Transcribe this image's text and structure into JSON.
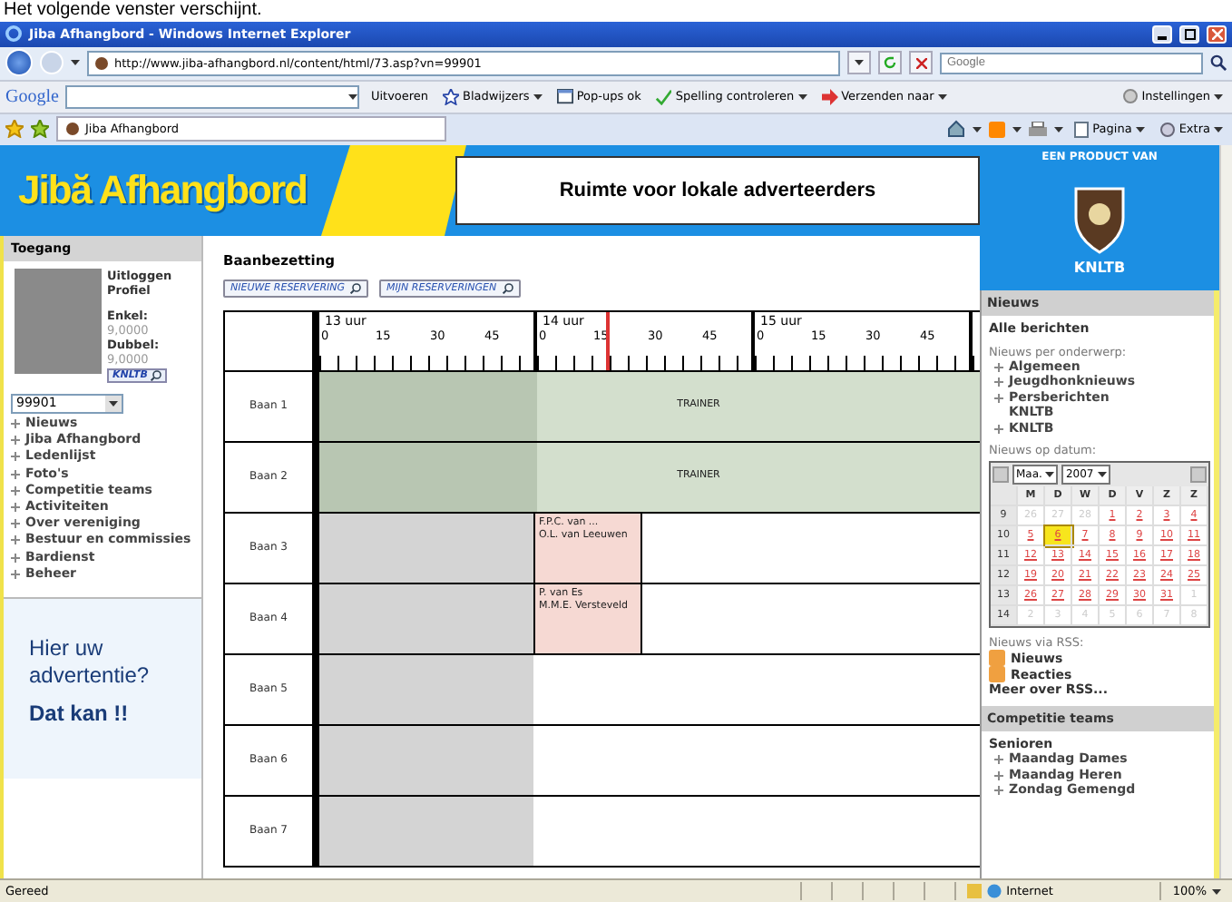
{
  "caption": "Het volgende venster verschijnt.",
  "window": {
    "title": "Jiba Afhangbord - Windows Internet Explorer"
  },
  "address_bar": {
    "url": "http://www.jiba-afhangbord.nl/content/html/73.asp?vn=99901",
    "search_placeholder": "Google"
  },
  "google_toolbar": {
    "logo": "Google",
    "search_button": "Uitvoeren",
    "items": [
      {
        "label": "Bladwijzers",
        "kind": "star",
        "dropdown": true
      },
      {
        "label": "Pop-ups ok",
        "kind": "popup",
        "dropdown": false
      },
      {
        "label": "Spelling controleren",
        "kind": "spell",
        "dropdown": true
      },
      {
        "label": "Verzenden naar",
        "kind": "send",
        "dropdown": true
      }
    ],
    "settings": "Instellingen"
  },
  "tab": {
    "title": "Jiba Afhangbord"
  },
  "command_bar": [
    {
      "label": "Pagina",
      "kind": "page"
    },
    {
      "label": "Extra",
      "kind": "tools"
    }
  ],
  "site_header": {
    "logo": "Jibă Afhangbord",
    "ad": "Ruimte voor lokale adverteerders",
    "product_of": "EEN PRODUCT VAN",
    "brand": "KNLTB"
  },
  "login": {
    "heading": "Toegang",
    "links": [
      "Uitloggen",
      "Profiel"
    ],
    "ratings": [
      {
        "label": "Enkel:",
        "value": "9,0000"
      },
      {
        "label": "Dubbel:",
        "value": "9,0000"
      }
    ],
    "badge": "KNLTB",
    "member_select": "99901"
  },
  "menu": [
    "Nieuws",
    "Jiba Afhangbord",
    "Ledenlijst",
    "Foto's",
    "Competitie teams",
    "Activiteiten",
    "Over vereniging",
    "Bestuur en commissies",
    "Bardienst",
    "Beheer"
  ],
  "advert": {
    "title": "Hier uw advertentie?",
    "subtitle": "Dat kan !!"
  },
  "schedule": {
    "title": "Baanbezetting",
    "buttons": [
      "NIEUWE RESERVERING",
      "MIJN RESERVERINGEN"
    ],
    "hours": [
      {
        "label": "13 uur",
        "minutes": [
          "0",
          "15",
          "30",
          "45"
        ]
      },
      {
        "label": "14 uur",
        "minutes": [
          "0",
          "15",
          "30",
          "45"
        ]
      },
      {
        "label": "15 uur",
        "minutes": [
          "0",
          "15",
          "30",
          "45"
        ]
      }
    ],
    "courts": [
      {
        "name": "Baan 1",
        "booking": {
          "kind": "trainer",
          "lines": [
            "TRAINER"
          ]
        }
      },
      {
        "name": "Baan 2",
        "booking": {
          "kind": "trainer",
          "lines": [
            "TRAINER"
          ]
        }
      },
      {
        "name": "Baan 3",
        "booking": {
          "kind": "reservation",
          "lines": [
            "F.P.C. van ...",
            "O.L. van Leeuwen"
          ]
        }
      },
      {
        "name": "Baan 4",
        "booking": {
          "kind": "reservation",
          "lines": [
            "P. van Es",
            "M.M.E. Versteveld"
          ]
        }
      },
      {
        "name": "Baan 5"
      },
      {
        "name": "Baan 6"
      },
      {
        "name": "Baan 7"
      }
    ]
  },
  "news": {
    "heading": "Nieuws",
    "all": "Alle berichten",
    "by_topic": "Nieuws per onderwerp:",
    "topics": [
      "Algemeen",
      "Jeugdhonknieuws",
      "Persberichten KNLTB",
      "KNLTB"
    ],
    "by_date": "Nieuws op datum:"
  },
  "calendar": {
    "month": "Maa.",
    "year": "2007",
    "weekdays": [
      "M",
      "D",
      "W",
      "D",
      "V",
      "Z",
      "Z"
    ],
    "weeks": [
      {
        "number": "9",
        "days": [
          {
            "day": "26",
            "muted": true,
            "selected": false
          },
          {
            "day": "27",
            "muted": true,
            "selected": false
          },
          {
            "day": "28",
            "muted": true,
            "selected": false
          },
          {
            "day": "1",
            "muted": false,
            "selected": false
          },
          {
            "day": "2",
            "muted": false,
            "selected": false
          },
          {
            "day": "3",
            "muted": false,
            "selected": false
          },
          {
            "day": "4",
            "muted": false,
            "selected": false
          }
        ]
      },
      {
        "number": "10",
        "days": [
          {
            "day": "5",
            "muted": false,
            "selected": false
          },
          {
            "day": "6",
            "muted": false,
            "selected": true
          },
          {
            "day": "7",
            "muted": false,
            "selected": false
          },
          {
            "day": "8",
            "muted": false,
            "selected": false
          },
          {
            "day": "9",
            "muted": false,
            "selected": false
          },
          {
            "day": "10",
            "muted": false,
            "selected": false
          },
          {
            "day": "11",
            "muted": false,
            "selected": false
          }
        ]
      },
      {
        "number": "11",
        "days": [
          {
            "day": "12",
            "muted": false,
            "selected": false
          },
          {
            "day": "13",
            "muted": false,
            "selected": false
          },
          {
            "day": "14",
            "muted": false,
            "selected": false
          },
          {
            "day": "15",
            "muted": false,
            "selected": false
          },
          {
            "day": "16",
            "muted": false,
            "selected": false
          },
          {
            "day": "17",
            "muted": false,
            "selected": false
          },
          {
            "day": "18",
            "muted": false,
            "selected": false
          }
        ]
      },
      {
        "number": "12",
        "days": [
          {
            "day": "19",
            "muted": false,
            "selected": false
          },
          {
            "day": "20",
            "muted": false,
            "selected": false
          },
          {
            "day": "21",
            "muted": false,
            "selected": false
          },
          {
            "day": "22",
            "muted": false,
            "selected": false
          },
          {
            "day": "23",
            "muted": false,
            "selected": false
          },
          {
            "day": "24",
            "muted": false,
            "selected": false
          },
          {
            "day": "25",
            "muted": false,
            "selected": false
          }
        ]
      },
      {
        "number": "13",
        "days": [
          {
            "day": "26",
            "muted": false,
            "selected": false
          },
          {
            "day": "27",
            "muted": false,
            "selected": false
          },
          {
            "day": "28",
            "muted": false,
            "selected": false
          },
          {
            "day": "29",
            "muted": false,
            "selected": false
          },
          {
            "day": "30",
            "muted": false,
            "selected": false
          },
          {
            "day": "31",
            "muted": false,
            "selected": false
          },
          {
            "day": "1",
            "muted": true,
            "selected": false
          }
        ]
      },
      {
        "number": "14",
        "days": [
          {
            "day": "2",
            "muted": true,
            "selected": false
          },
          {
            "day": "3",
            "muted": true,
            "selected": false
          },
          {
            "day": "4",
            "muted": true,
            "selected": false
          },
          {
            "day": "5",
            "muted": true,
            "selected": false
          },
          {
            "day": "6",
            "muted": true,
            "selected": false
          },
          {
            "day": "7",
            "muted": true,
            "selected": false
          },
          {
            "day": "8",
            "muted": true,
            "selected": false
          }
        ]
      }
    ]
  },
  "rss": {
    "heading": "Nieuws via RSS:",
    "feeds": [
      "Nieuws",
      "Reacties"
    ],
    "more": "Meer over RSS..."
  },
  "teams": {
    "heading": "Competitie teams",
    "group": "Senioren",
    "items": [
      "Maandag Dames",
      "Maandag Heren",
      "Zondag Gemengd"
    ]
  },
  "status_bar": {
    "text": "Gereed",
    "zone": "Internet",
    "zoom": "100%"
  }
}
